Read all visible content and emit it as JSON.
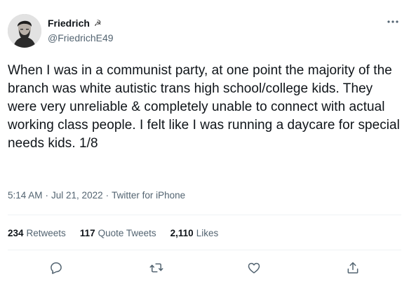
{
  "author": {
    "display_name": "Friedrich",
    "name_emoji": "☭",
    "handle": "@FriedrichE49"
  },
  "tweet": {
    "text": "When I was in a communist party, at one point the majority of the branch was white autistic trans high school/college kids. They were very unreliable & completely unable to connect with actual working class people. I felt like I was running a daycare for special needs kids. 1/8",
    "time": "5:14 AM",
    "separator1": "·",
    "date": "Jul 21, 2022",
    "separator2": "·",
    "source": "Twitter for iPhone"
  },
  "stats": {
    "retweets_count": "234",
    "retweets_label": "Retweets",
    "quotes_count": "117",
    "quotes_label": "Quote Tweets",
    "likes_count": "2,110",
    "likes_label": "Likes"
  },
  "icons": {
    "more": "more-horizontal-icon",
    "reply": "reply-icon",
    "retweet": "retweet-icon",
    "like": "heart-icon",
    "share": "share-icon"
  },
  "colors": {
    "text_primary": "#0f1419",
    "text_secondary": "#536471",
    "divider": "#eff3f4"
  }
}
